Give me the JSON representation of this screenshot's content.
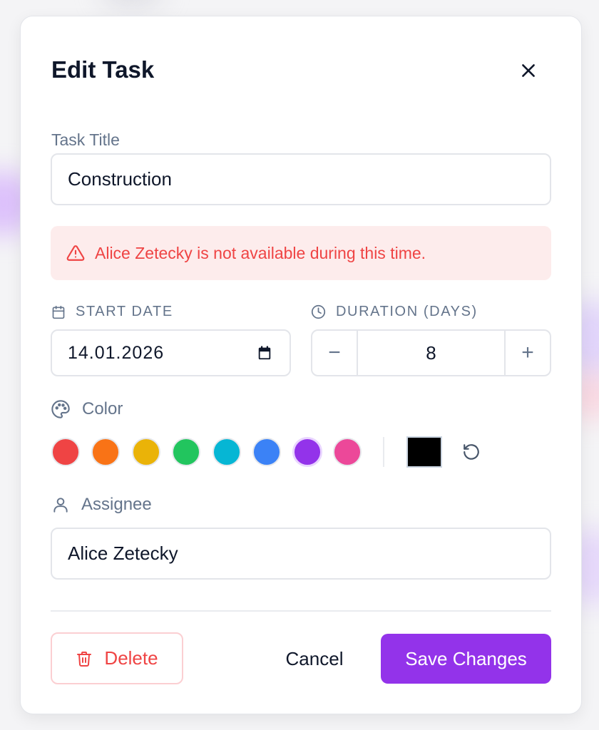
{
  "dialog": {
    "title": "Edit Task"
  },
  "task_title": {
    "label": "Task Title",
    "value": "Construction"
  },
  "alert": {
    "message": "Alice Zetecky is not available during this time.",
    "color": "#ef4444",
    "background": "#fdecec"
  },
  "start_date": {
    "label": "START DATE",
    "value": "14.01.2026"
  },
  "duration": {
    "label": "DURATION (DAYS)",
    "value": "8",
    "decrement": "−",
    "increment": "+"
  },
  "color": {
    "label": "Color",
    "swatches": [
      "#ef4444",
      "#f97316",
      "#eab308",
      "#22c55e",
      "#06b6d4",
      "#3b82f6",
      "#9333ea",
      "#ec4899"
    ],
    "selected": "#9333ea",
    "custom": "#000000"
  },
  "assignee": {
    "label": "Assignee",
    "value": "Alice Zetecky"
  },
  "footer": {
    "delete_label": "Delete",
    "cancel_label": "Cancel",
    "save_label": "Save Changes",
    "accent": "#9333ea"
  }
}
